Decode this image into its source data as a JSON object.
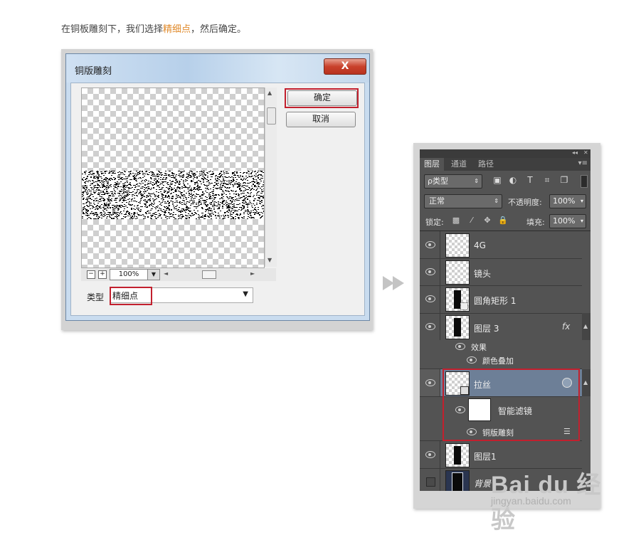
{
  "caption": {
    "before": "在铜板雕刻下，我们选择",
    "highlight": "精细点",
    "after": "，然后确定。"
  },
  "dialog": {
    "title": "铜版雕刻",
    "close": "X",
    "ok": "确定",
    "cancel": "取消",
    "zoom": "100%",
    "zoom_out": "−",
    "zoom_in": "+",
    "type_label": "类型",
    "type_value": "精细点"
  },
  "panel": {
    "tabs": [
      "图层",
      "通道",
      "路径"
    ],
    "filter": "ρ类型",
    "blend": "正常",
    "opacity_label": "不透明度:",
    "opacity": "100%",
    "lock_label": "锁定:",
    "fill_label": "填充:",
    "fill": "100%",
    "layers": [
      {
        "name": "4G"
      },
      {
        "name": "镜头"
      },
      {
        "name": "圆角矩形 1"
      },
      {
        "name": "图层 3",
        "fx": "fx"
      },
      {
        "name": "效果"
      },
      {
        "name": "颜色叠加"
      },
      {
        "name": "拉丝"
      },
      {
        "name": "智能滤镜"
      },
      {
        "name": "铜版雕刻"
      },
      {
        "name": "图层1"
      },
      {
        "name": "背景"
      }
    ]
  },
  "watermark": {
    "word": "Bai du 经验",
    "url": "jingyan.baidu.com"
  },
  "colors": {
    "highlight_red": "#c2202e",
    "caption_orange": "#e08a2b",
    "panel_bg": "#535353",
    "selected_layer": "#6d7f97"
  }
}
